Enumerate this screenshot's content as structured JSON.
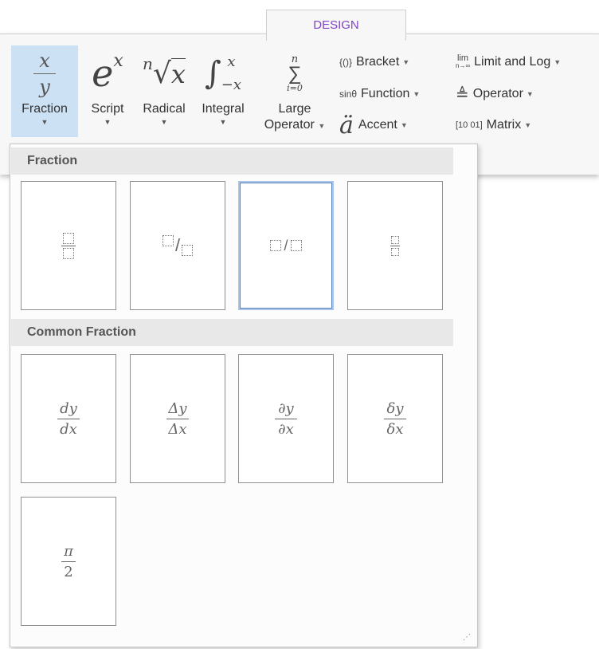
{
  "ribbon": {
    "tab": "DESIGN",
    "accent_color": "#7f45c4",
    "buttons": {
      "fraction": {
        "label": "Fraction",
        "icon": "fraction-icon"
      },
      "script": {
        "label": "Script",
        "icon": "script-icon"
      },
      "radical": {
        "label": "Radical",
        "icon": "radical-icon"
      },
      "integral": {
        "label": "Integral",
        "icon": "integral-icon"
      },
      "large_operator": {
        "label_line1": "Large",
        "label_line2": "Operator",
        "icon": "summation-icon"
      }
    },
    "small_buttons": {
      "bracket": "Bracket",
      "function": "Function",
      "accent": "Accent",
      "limit_log": "Limit and Log",
      "operator": "Operator",
      "matrix": "Matrix"
    },
    "icons": {
      "fraction_num": "x",
      "fraction_den": "y",
      "script_base": "e",
      "script_sup": "x",
      "radical_index": "n",
      "radical_arg": "x",
      "integral_upper": "x",
      "integral_lower": "−x",
      "sum_upper": "n",
      "sum_lower": "i=0",
      "bracket_icon": "{()}",
      "function_icon": "sinθ",
      "accent_icon": "ä",
      "limit_icon": "lim",
      "limit_sub": "n→∞",
      "operator_icon": "≜",
      "matrix_icon": "[10 01]"
    }
  },
  "gallery": {
    "section_fraction": "Fraction",
    "section_common": "Common Fraction",
    "common": [
      {
        "num": "dy",
        "den": "dx"
      },
      {
        "num": "Δy",
        "den": "Δx"
      },
      {
        "num": "∂y",
        "den": "∂x"
      },
      {
        "num": "δy",
        "den": "δx"
      },
      {
        "num": "π",
        "den": "2"
      }
    ]
  }
}
